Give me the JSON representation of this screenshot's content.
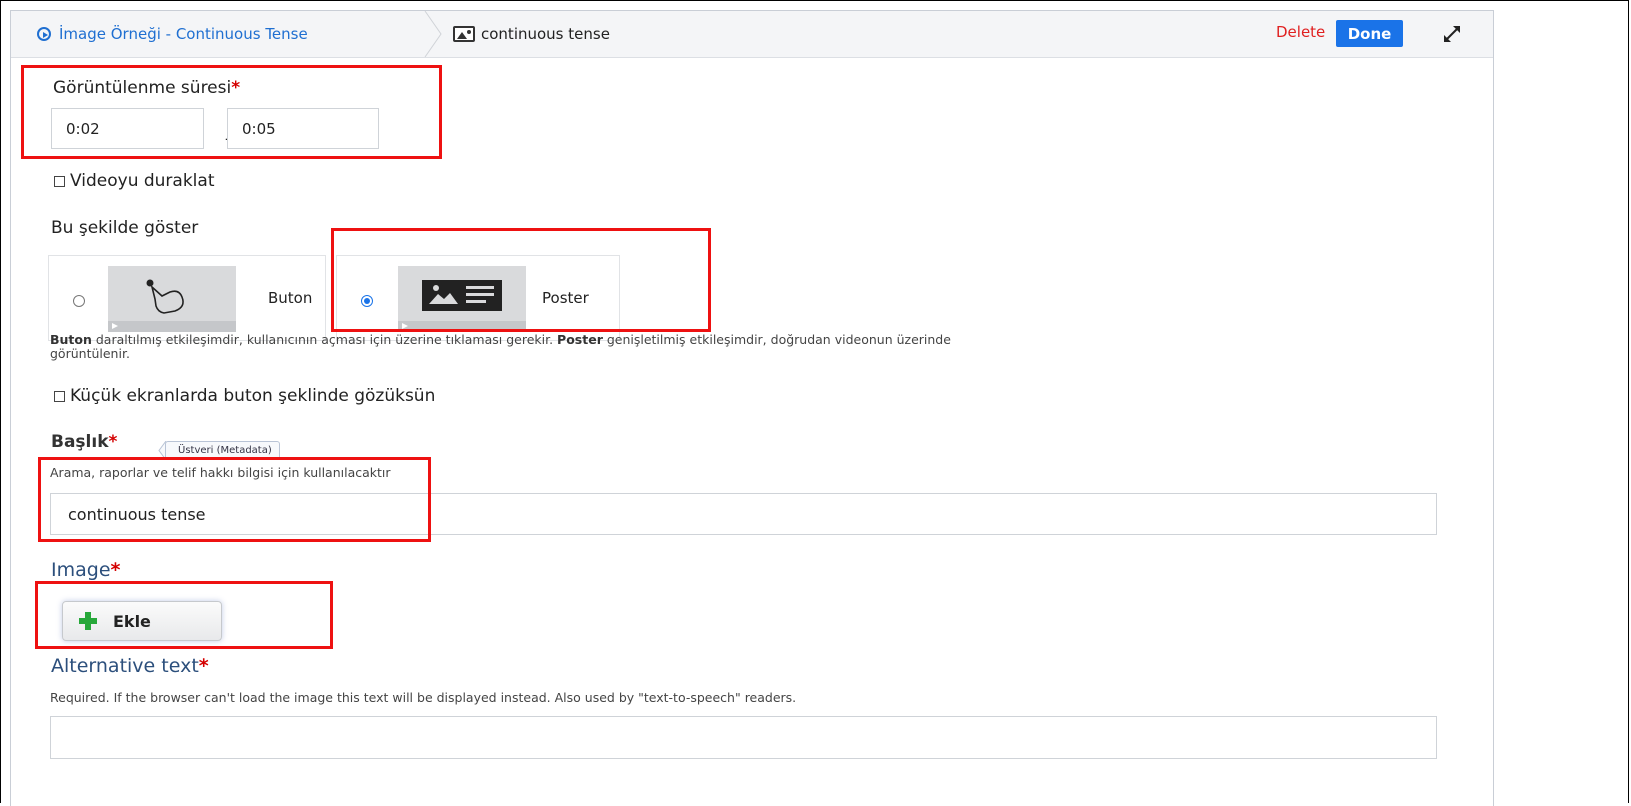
{
  "header": {
    "crumb_interaction": "İmage Örneği - Continuous Tense",
    "crumb_element": "continuous tense",
    "delete_label": "Delete",
    "done_label": "Done"
  },
  "display_time": {
    "label": "Görüntülenme süresi",
    "required_mark": "*",
    "start": "0:02",
    "separator": "-",
    "end": "0:05"
  },
  "pause_video": {
    "label": "Videoyu duraklat",
    "checked": false
  },
  "display_as": {
    "label": "Bu şekilde göster",
    "options": [
      {
        "label": "Buton",
        "selected": false
      },
      {
        "label": "Poster",
        "selected": true
      }
    ],
    "help_b1": "Buton",
    "help_t1": " daraltılmış etkileşimdir, kullanıcının açması için üzerine tıklaması gerekir. ",
    "help_b2": "Poster",
    "help_t2": " genişletilmiş etkileşimdir, doğrudan videonun üzerinde",
    "help_line2": "görüntülenir."
  },
  "small_screens": {
    "label": "Küçük ekranlarda buton şeklinde gözüksün",
    "checked": false
  },
  "title_field": {
    "label": "Başlık",
    "required_mark": "*",
    "meta_tag": "Üstveri (Metadata)",
    "help": "Arama, raporlar ve telif hakkı bilgisi için kullanılacaktır",
    "value": "continuous tense"
  },
  "image_field": {
    "label": "Image",
    "required_mark": "*",
    "add_label": "Ekle"
  },
  "alt_text": {
    "label": "Alternative text",
    "required_mark": "*",
    "help": "Required. If the browser can't load the image this text will be displayed instead. Also used by \"text-to-speech\" readers.",
    "value": ""
  },
  "colors": {
    "accent": "#1a73e8",
    "delete": "#e02020",
    "highlight": "#ee1111",
    "section_label": "#2c4f7c"
  }
}
